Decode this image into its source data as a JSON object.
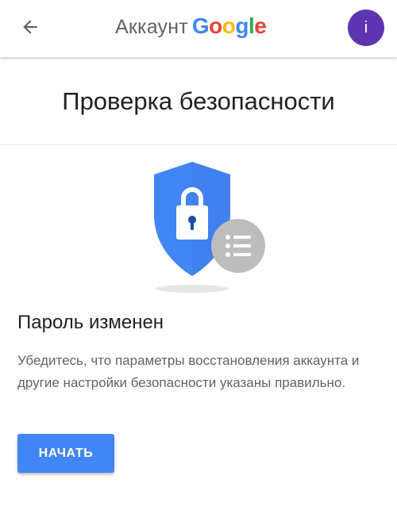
{
  "header": {
    "title_prefix": "Аккаунт",
    "brand_letters": [
      "G",
      "o",
      "o",
      "g",
      "l",
      "e"
    ],
    "avatar_initial": "i",
    "back_icon": "arrow-back-icon"
  },
  "page_title": "Проверка безопасности",
  "illustration": {
    "icon": "security-shield-lock-icon",
    "badge_icon": "list-icon"
  },
  "content": {
    "heading": "Пароль изменен",
    "description": "Убедитесь, что параметры восстановления аккаунта и другие настройки безопасности указаны правильно.",
    "start_button": "НАЧАТЬ"
  },
  "colors": {
    "accent": "#4285f4",
    "avatar": "#5e35b1",
    "google_blue": "#4285f4",
    "google_red": "#ea4335",
    "google_yellow": "#fbbc05",
    "google_green": "#34a853"
  }
}
